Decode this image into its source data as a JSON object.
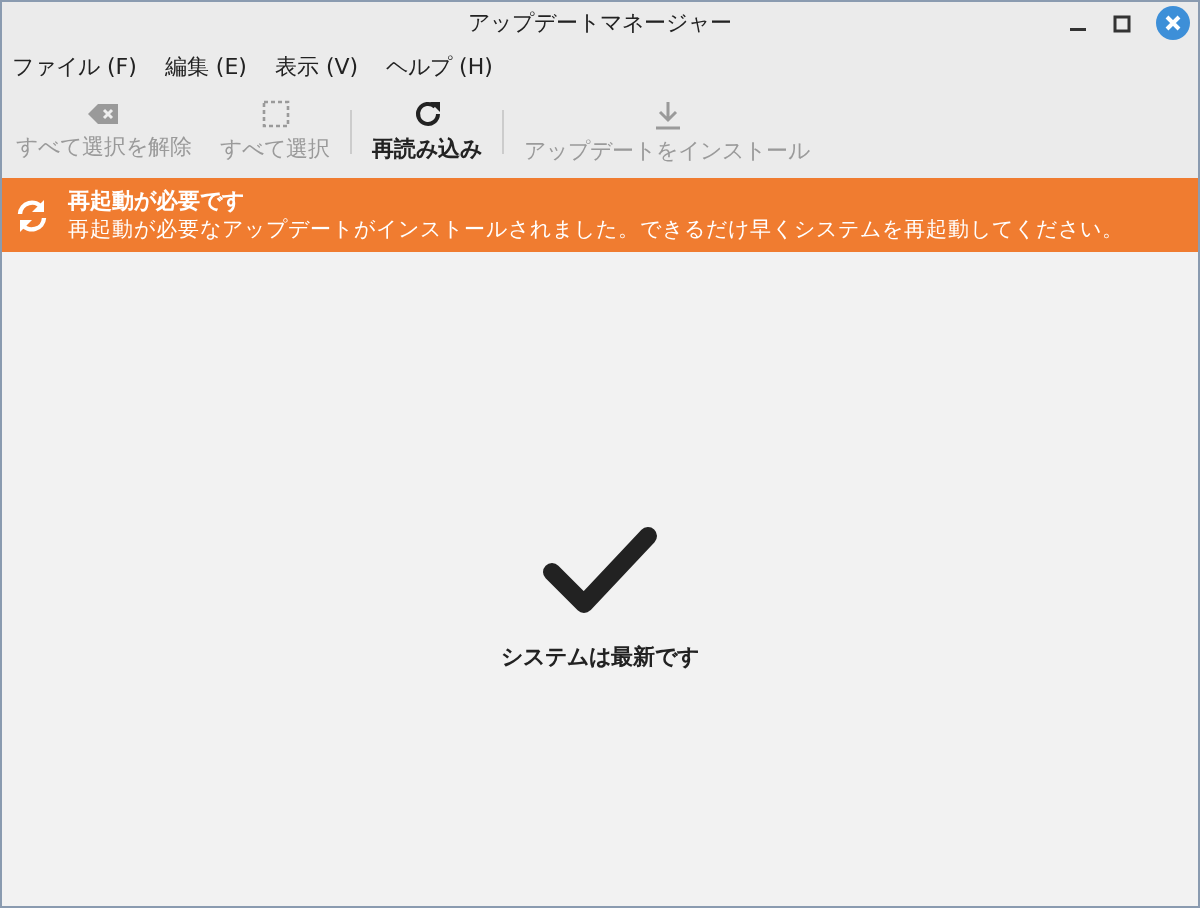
{
  "window": {
    "title": "アップデートマネージャー"
  },
  "menu": [
    "ファイル (F)",
    "編集 (E)",
    "表示 (V)",
    "ヘルプ (H)"
  ],
  "toolbar": [
    {
      "kind": "clear",
      "label": "すべて選択を解除",
      "disabled": true
    },
    {
      "kind": "select",
      "label": "すべて選択",
      "disabled": true
    },
    {
      "kind": "refresh",
      "label": "再読み込み",
      "disabled": false
    },
    {
      "kind": "install",
      "label": "アップデートをインストール",
      "disabled": true
    }
  ],
  "banner": {
    "title": "再起動が必要です",
    "message": "再起動が必要なアップデートがインストールされました。できるだけ早くシステムを再起動してください。"
  },
  "status": {
    "message": "システムは最新です"
  }
}
